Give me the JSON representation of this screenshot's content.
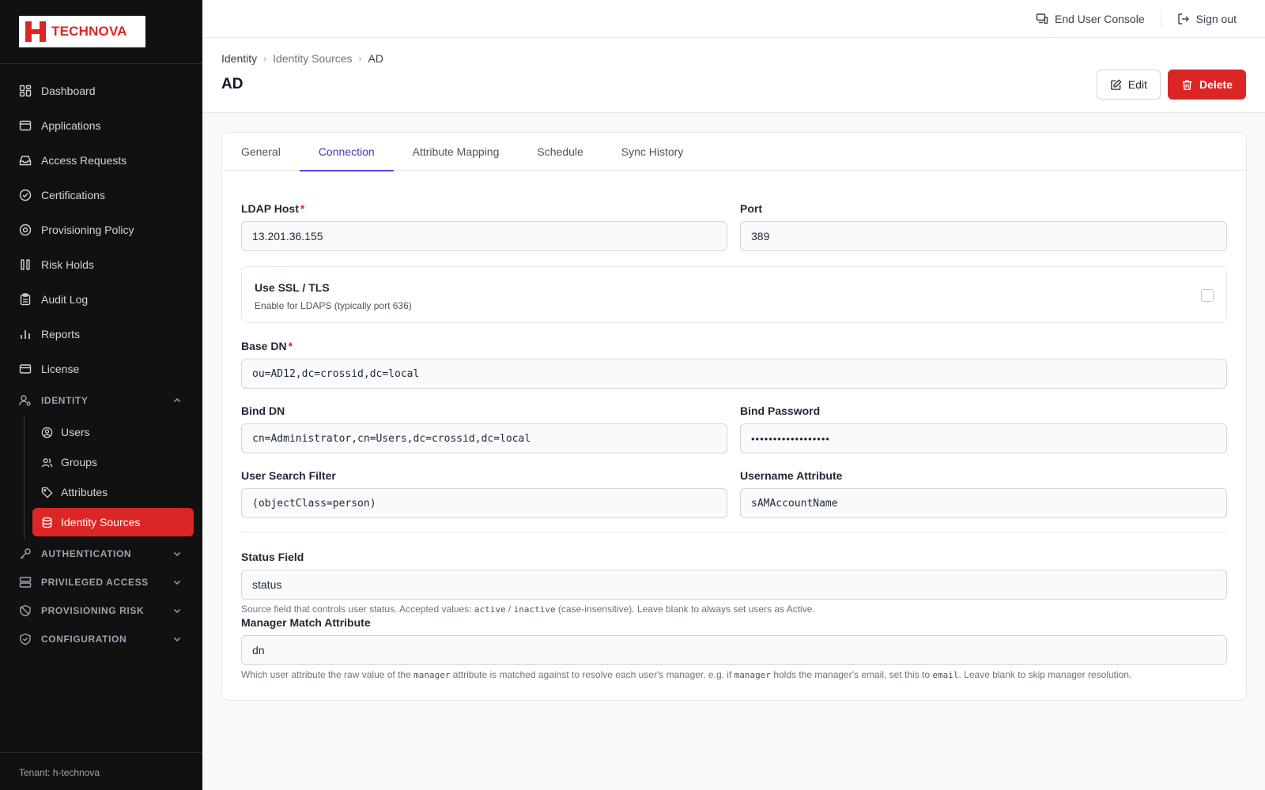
{
  "brand": {
    "name": "TECHNOVA",
    "color": "#dc2626"
  },
  "sidebar": {
    "items": [
      {
        "label": "Dashboard",
        "icon": "dashboard-icon"
      },
      {
        "label": "Applications",
        "icon": "applications-icon"
      },
      {
        "label": "Access Requests",
        "icon": "inbox-icon"
      },
      {
        "label": "Certifications",
        "icon": "check-circle-icon"
      },
      {
        "label": "Provisioning Policy",
        "icon": "policy-icon"
      },
      {
        "label": "Risk Holds",
        "icon": "pause-icon"
      },
      {
        "label": "Audit Log",
        "icon": "clipboard-icon"
      },
      {
        "label": "Reports",
        "icon": "bar-chart-icon"
      },
      {
        "label": "License",
        "icon": "license-icon"
      }
    ],
    "identity_section": {
      "label": "IDENTITY",
      "sub_items": [
        {
          "label": "Users",
          "icon": "user-circle-icon"
        },
        {
          "label": "Groups",
          "icon": "users-icon"
        },
        {
          "label": "Attributes",
          "icon": "tag-icon"
        },
        {
          "label": "Identity Sources",
          "icon": "database-icon",
          "active": true
        }
      ]
    },
    "sections": [
      {
        "label": "AUTHENTICATION",
        "icon": "key-icon"
      },
      {
        "label": "PRIVILEGED ACCESS",
        "icon": "server-icon"
      },
      {
        "label": "PROVISIONING RISK",
        "icon": "shield-off-icon"
      },
      {
        "label": "CONFIGURATION",
        "icon": "shield-icon"
      }
    ],
    "tenant": "Tenant: h-technova"
  },
  "topbar": {
    "end_user_console": "End User Console",
    "sign_out": "Sign out"
  },
  "header": {
    "breadcrumb": [
      "Identity",
      "Identity Sources",
      "AD"
    ],
    "title": "AD",
    "edit_label": "Edit",
    "delete_label": "Delete"
  },
  "tabs": [
    {
      "label": "General"
    },
    {
      "label": "Connection",
      "active": true
    },
    {
      "label": "Attribute Mapping"
    },
    {
      "label": "Schedule"
    },
    {
      "label": "Sync History"
    }
  ],
  "form": {
    "ldap_host": {
      "label": "LDAP Host",
      "value": "13.201.36.155",
      "required": true
    },
    "port": {
      "label": "Port",
      "value": "389"
    },
    "ssl": {
      "title": "Use SSL / TLS",
      "description": "Enable for LDAPS (typically port 636)",
      "checked": false
    },
    "base_dn": {
      "label": "Base DN",
      "value": "ou=AD12,dc=crossid,dc=local",
      "required": true
    },
    "bind_dn": {
      "label": "Bind DN",
      "value": "cn=Administrator,cn=Users,dc=crossid,dc=local"
    },
    "bind_password": {
      "label": "Bind Password",
      "value": "••••••••••••••••••"
    },
    "user_search_filter": {
      "label": "User Search Filter",
      "value": "(objectClass=person)"
    },
    "username_attribute": {
      "label": "Username Attribute",
      "value": "sAMAccountName"
    },
    "status_field": {
      "label": "Status Field",
      "value": "status",
      "help_pre": "Source field that controls user status. Accepted values: ",
      "help_code1": "active",
      "help_mid": " / ",
      "help_code2": "inactive",
      "help_post": " (case-insensitive). Leave blank to always set users as Active."
    },
    "manager_match": {
      "label": "Manager Match Attribute",
      "value": "dn",
      "help_1": "Which user attribute the raw value of the ",
      "help_code1": "manager",
      "help_2": " attribute is matched against to resolve each user's manager. e.g. if ",
      "help_code2": "manager",
      "help_3": " holds the manager's email, set this to ",
      "help_code3": "email",
      "help_4": ". Leave blank to skip manager resolution."
    }
  },
  "colors": {
    "accent": "#4f46e5",
    "danger": "#dc2626",
    "sidebar_bg": "#111111"
  }
}
